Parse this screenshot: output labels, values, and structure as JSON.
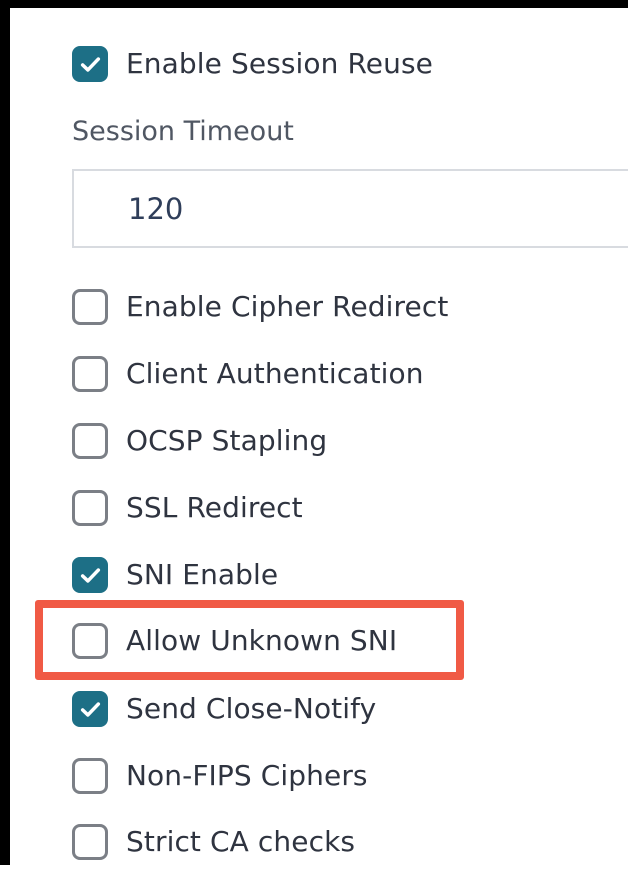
{
  "settings": {
    "enable_session_reuse": {
      "label": "Enable Session Reuse",
      "checked": true
    },
    "session_timeout": {
      "label": "Session Timeout",
      "value": "120"
    },
    "options": [
      {
        "label": "Enable Cipher Redirect",
        "checked": false
      },
      {
        "label": "Client Authentication",
        "checked": false
      },
      {
        "label": "OCSP Stapling",
        "checked": false
      },
      {
        "label": "SSL Redirect",
        "checked": false
      },
      {
        "label": "SNI Enable",
        "checked": true
      },
      {
        "label": "Allow Unknown SNI",
        "checked": false,
        "highlighted": true
      },
      {
        "label": "Send Close-Notify",
        "checked": true
      },
      {
        "label": "Non-FIPS Ciphers",
        "checked": false
      },
      {
        "label": "Strict CA checks",
        "checked": false
      }
    ]
  },
  "colors": {
    "checked_fill": "#1d6f86",
    "unchecked_border": "#7b7f86",
    "highlight_border": "#f05a45",
    "text": "#2f3440"
  },
  "icons": {
    "checked": "checkmark-icon"
  }
}
